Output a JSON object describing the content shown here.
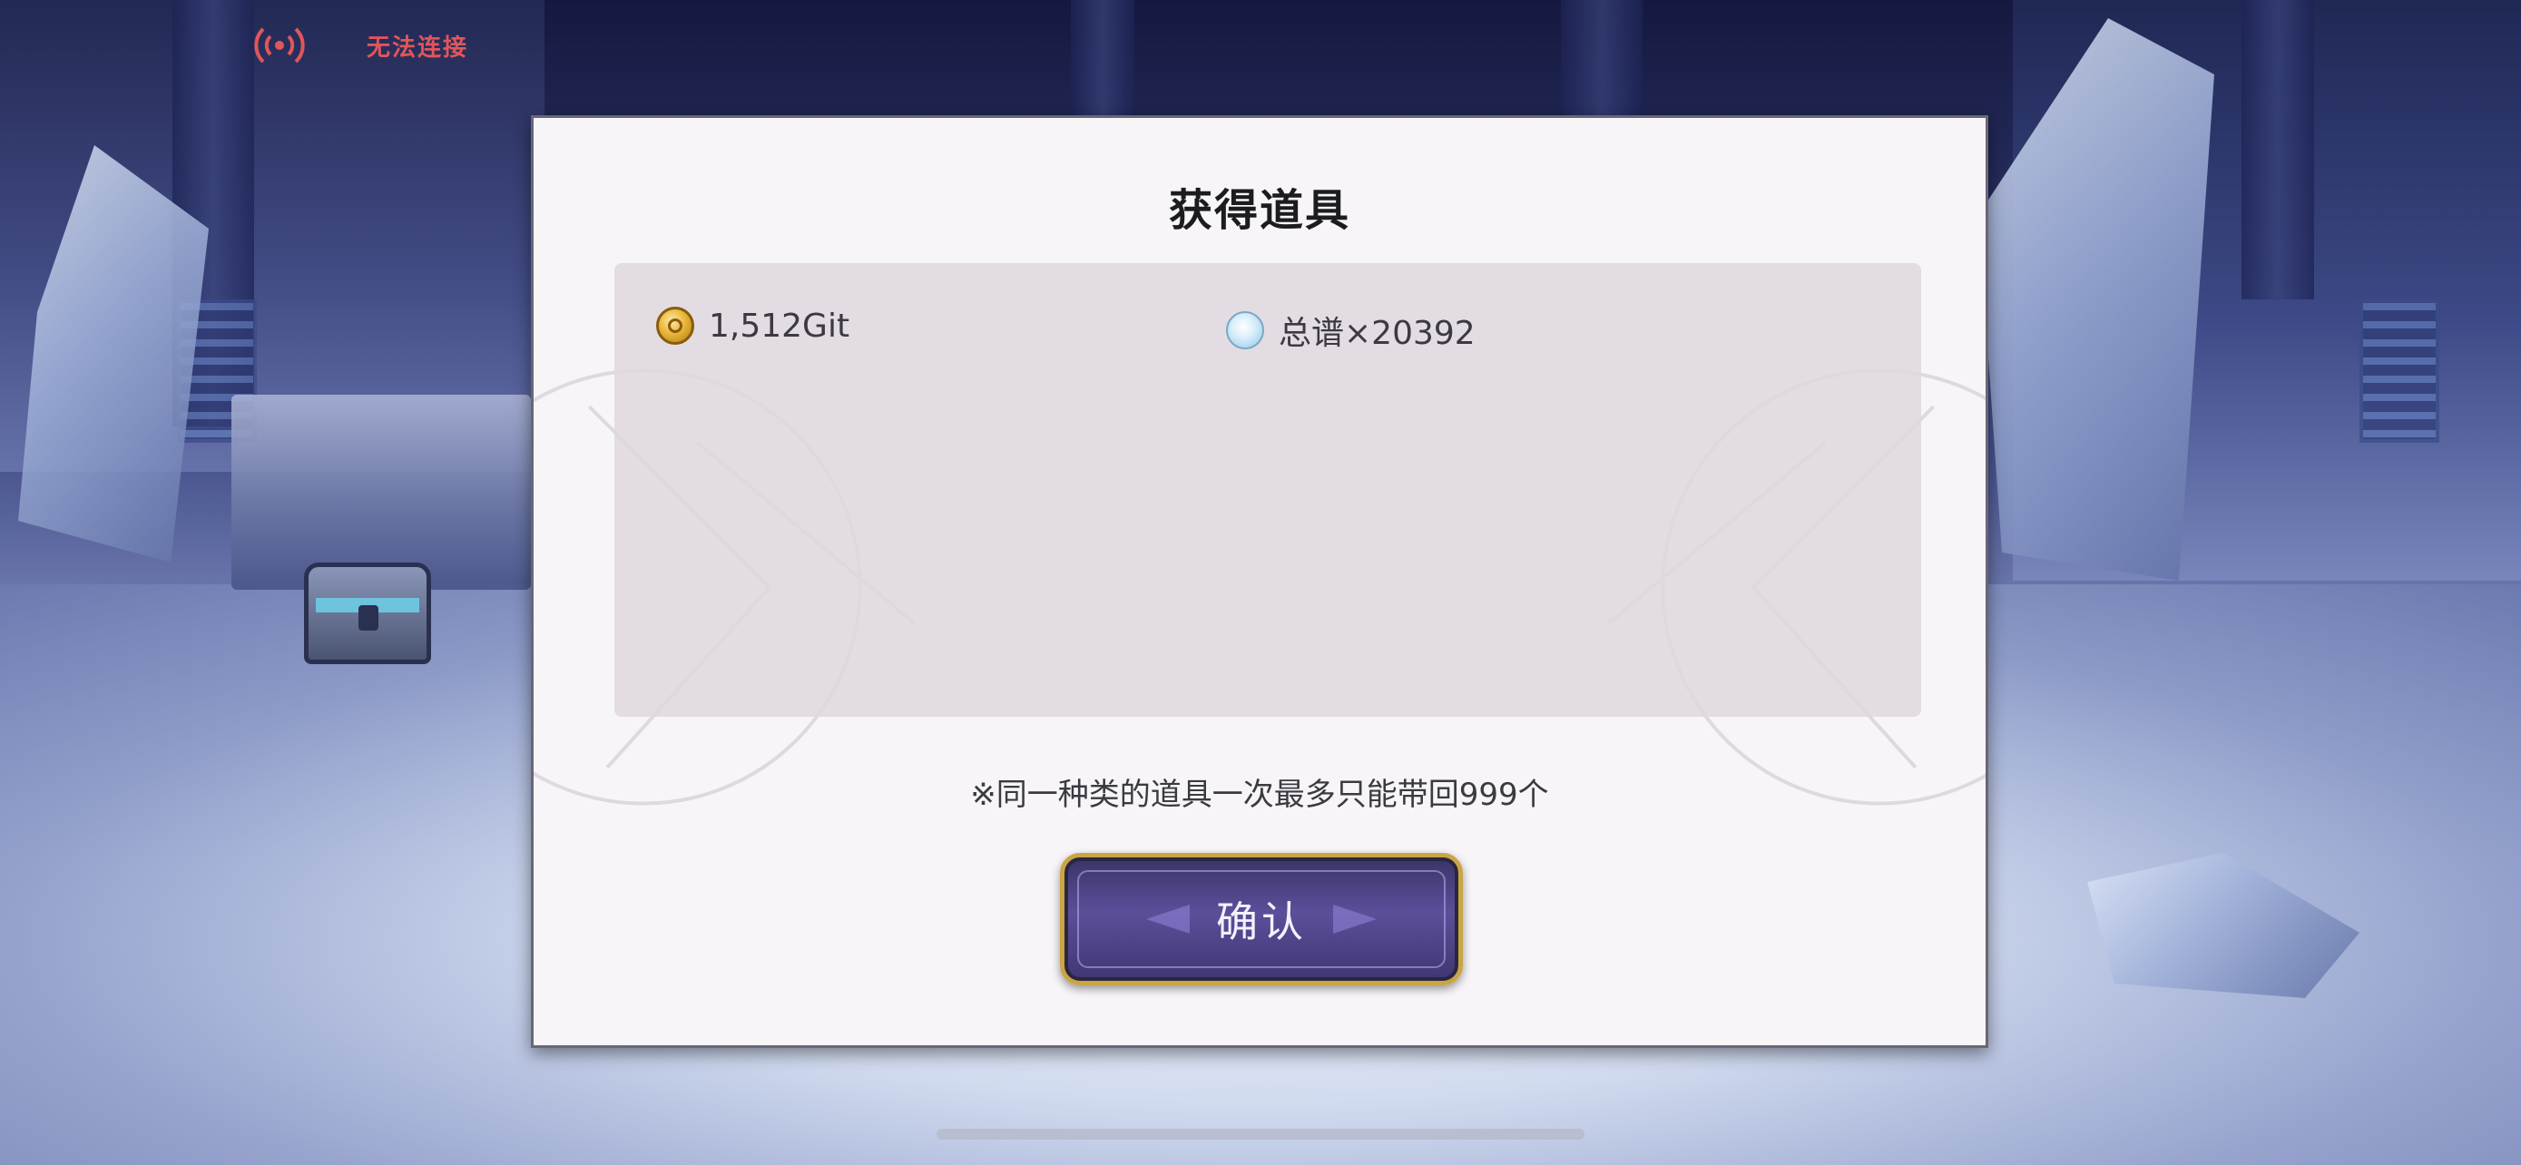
{
  "status": {
    "icon": "signal-broadcast-icon",
    "text": "无法连接",
    "color": "#e0565a"
  },
  "dialog": {
    "title": "获得道具",
    "items": [
      {
        "icon": "gold-coin-icon",
        "label": "1,512Git"
      },
      {
        "icon": "crystal-orb-icon",
        "label": "总谱×20392"
      }
    ],
    "note": "※同一种类的道具一次最多只能带回999个",
    "confirm_label": "确认"
  },
  "colors": {
    "dialog_bg": "#f7f5f8",
    "items_box_bg": "#ded8de",
    "button_border": "#c9a545",
    "button_fill": "#5b4f9a"
  }
}
